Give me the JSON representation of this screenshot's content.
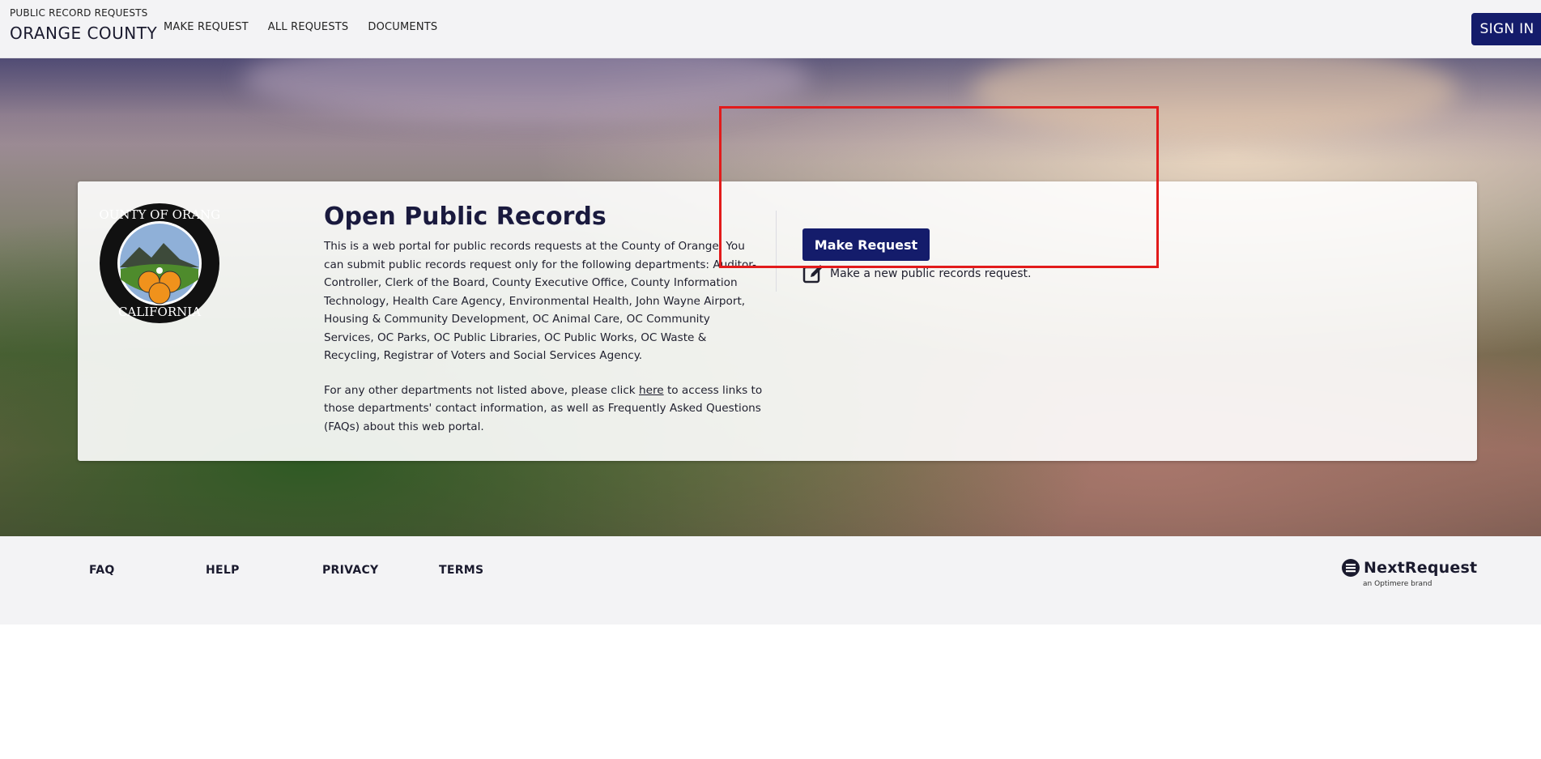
{
  "header": {
    "brand_small": "PUBLIC RECORD REQUESTS",
    "brand_big": "ORANGE COUNTY",
    "nav": [
      "MAKE REQUEST",
      "ALL REQUESTS",
      "DOCUMENTS"
    ],
    "sign_in": "SIGN IN"
  },
  "card": {
    "title": "Open Public Records",
    "seal": {
      "top_text": "COUNTY OF ORANGE",
      "bottom_text": "CALIFORNIA"
    },
    "para1": "This is a web portal for public records requests at the County of Orange. You can submit public records request only for the following departments: Auditor-Controller, Clerk of the Board, County Executive Office, County Information Technology, Health Care Agency, Environmental Health, John Wayne Airport, Housing & Community Development, OC Animal Care, OC Community Services, OC Parks, OC Public Libraries, OC Public Works, OC Waste & Recycling, Registrar of Voters and Social Services Agency.",
    "para2_before": "For any other departments not listed above, please click ",
    "para2_link": "here",
    "para2_after": " to access links to those departments' contact information, as well as Frequently Asked Questions (FAQs) about this web portal.",
    "make_request_button": "Make Request",
    "make_request_desc": "Make a new public records request."
  },
  "footer": {
    "links": [
      "FAQ",
      "HELP",
      "PRIVACY",
      "TERMS"
    ],
    "brand": "NextRequest",
    "brand_sub": "an Optimere brand"
  },
  "colors": {
    "primary": "#141c6b",
    "highlight": "#e21b1b",
    "header_bg": "#f3f3f5"
  }
}
